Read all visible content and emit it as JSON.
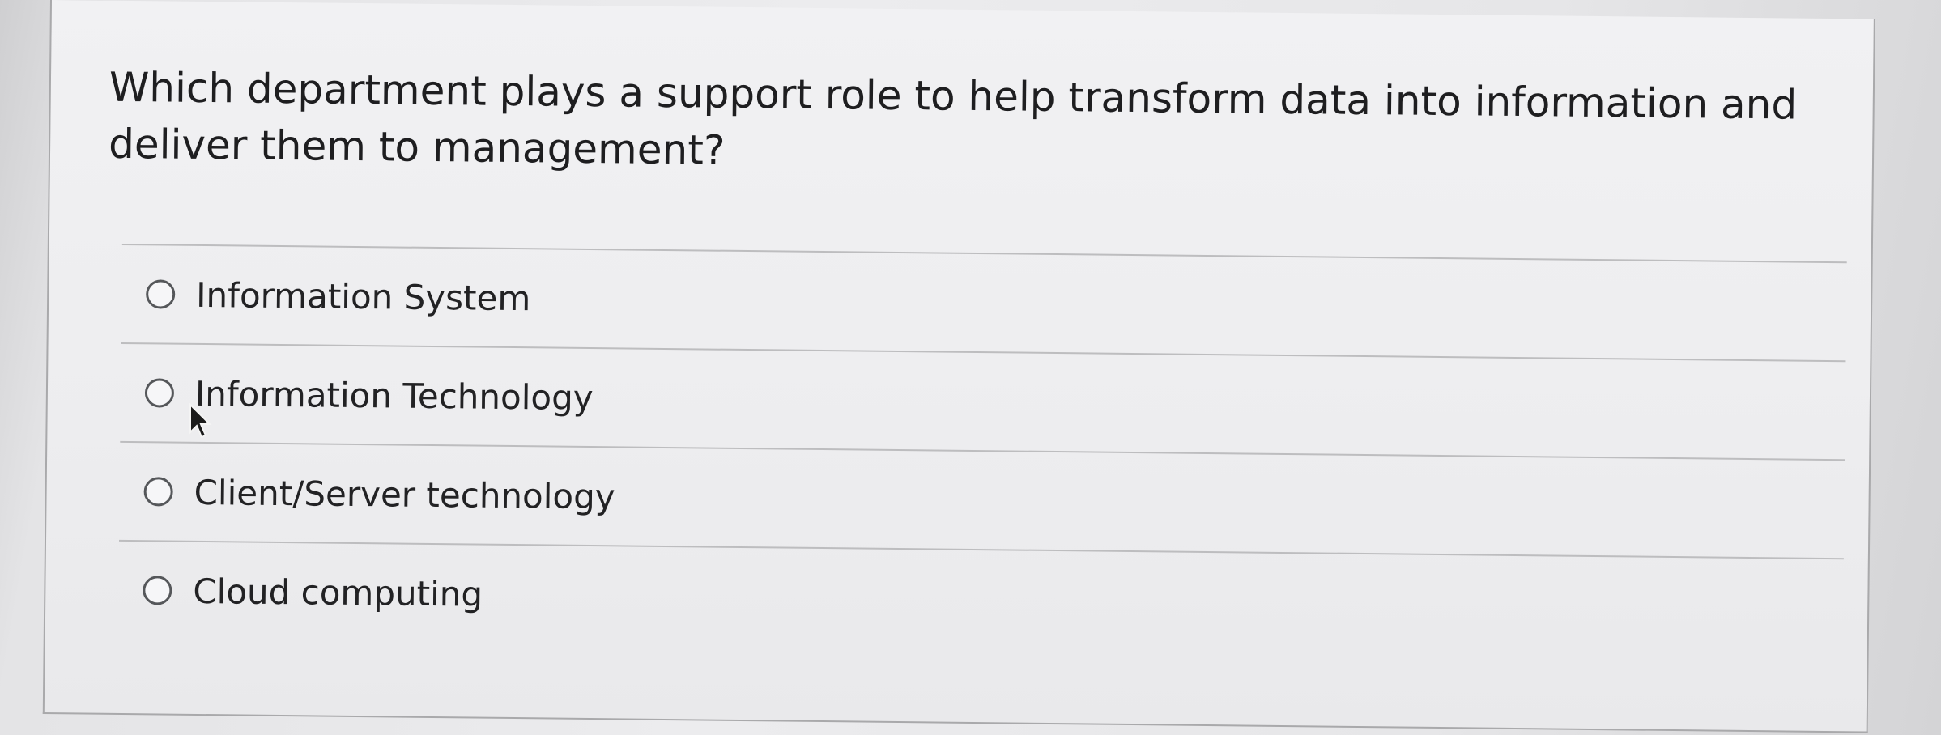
{
  "question": {
    "text": "Which department plays a support role to help transform data into information and deliver them to management?"
  },
  "options": [
    {
      "label": "Information System",
      "selected": false
    },
    {
      "label": "Information Technology",
      "selected": false
    },
    {
      "label": "Client/Server technology",
      "selected": false
    },
    {
      "label": "Cloud computing",
      "selected": false
    }
  ],
  "cursor": {
    "icon": "mouse-pointer-icon"
  }
}
